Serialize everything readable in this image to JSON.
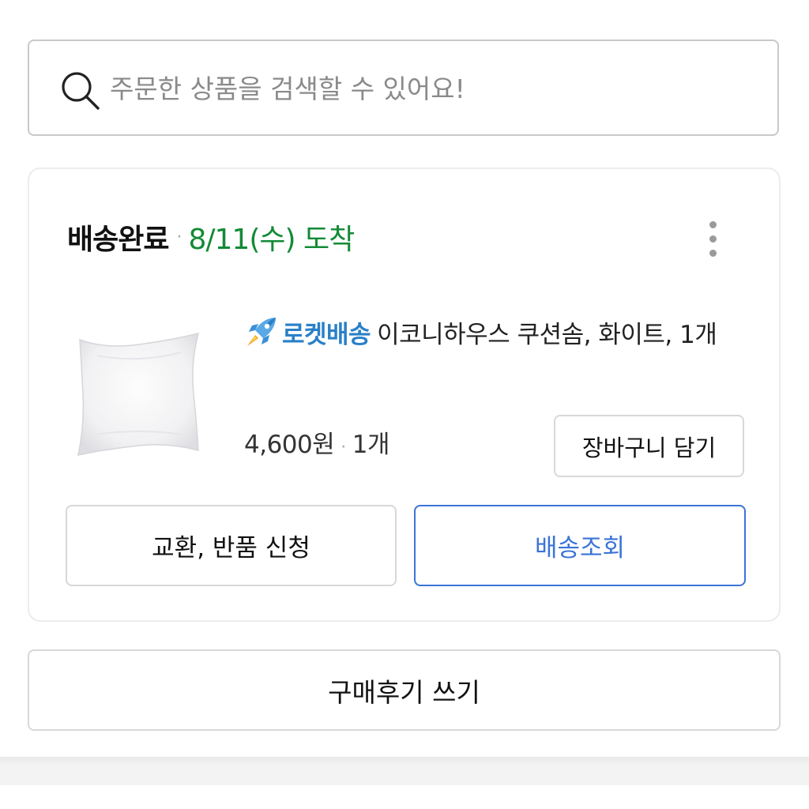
{
  "search": {
    "placeholder": "주문한 상품을 검색할 수 있어요!",
    "icon": "search-icon"
  },
  "order": {
    "status": "배송완료",
    "separator": "·",
    "arrival": "8/11(수) 도착",
    "arrival_color": "#138a36",
    "more_icon": "vertical-ellipsis-icon",
    "product": {
      "rocket_icon": "rocket-icon",
      "rocket_label": "로켓배송",
      "rocket_color": "#2a80c8",
      "name": "이코니하우스 쿠션솜, 화이트, 1개",
      "image": "white-cushion-image",
      "price": "4,600원",
      "quantity": "1개"
    },
    "buttons": {
      "add_to_cart": "장바구니 담기",
      "exchange_return": "교환, 반품 신청",
      "track_delivery": "배송조회"
    },
    "accent_color": "#3a74d8"
  },
  "review_button": "구매후기 쓰기"
}
